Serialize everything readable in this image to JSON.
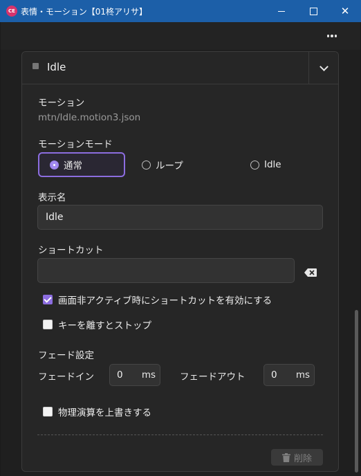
{
  "window": {
    "title": "表情・モーション【01柊アリサ】",
    "app_icon_text": "CE",
    "controls": {
      "minimize": "minimize",
      "maximize": "maximize",
      "close": "✕"
    }
  },
  "toolbar": {
    "more_icon": "more-horizontal-icon"
  },
  "panel": {
    "title": "Idle",
    "motion_label": "モーション",
    "motion_file": "mtn/Idle.motion3.json",
    "mode_label": "モーションモード",
    "mode_options": [
      {
        "label": "通常",
        "selected": true
      },
      {
        "label": "ループ",
        "selected": false
      },
      {
        "label": "Idle",
        "selected": false
      }
    ],
    "display_name_label": "表示名",
    "display_name_value": "Idle",
    "shortcut_label": "ショートカット",
    "shortcut_value": "",
    "checkbox_inactive_shortcut": {
      "label": "画面非アクティブ時にショートカットを有効にする",
      "checked": true
    },
    "checkbox_stop_on_release": {
      "label": "キーを離すとストップ",
      "checked": false
    },
    "fade_settings_label": "フェード設定",
    "fade_in": {
      "label": "フェードイン",
      "value": "0",
      "unit": "ms"
    },
    "fade_out": {
      "label": "フェードアウト",
      "value": "0",
      "unit": "ms"
    },
    "checkbox_physics_override": {
      "label": "物理演算を上書きする",
      "checked": false
    },
    "delete_button": "削除"
  },
  "colors": {
    "accent": "#8c6de0",
    "titlebar": "#1c5fa8",
    "background": "#1f1f1f",
    "panel": "#262626"
  }
}
